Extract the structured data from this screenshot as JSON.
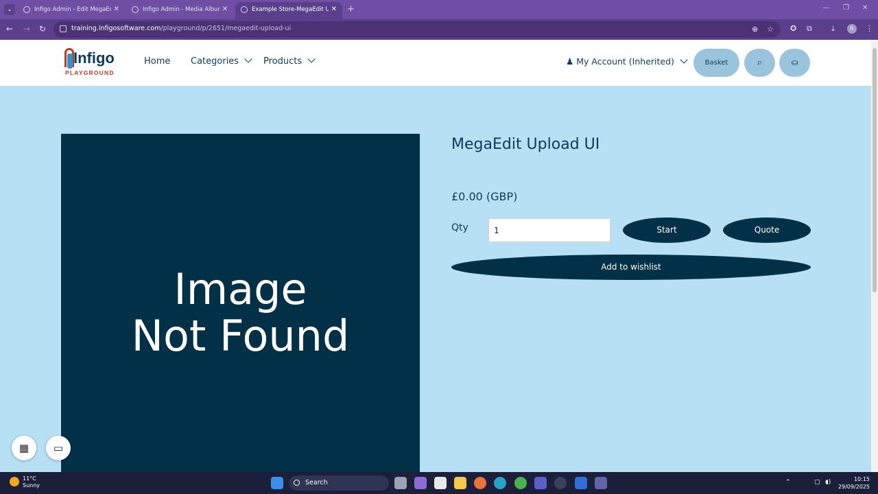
{
  "browser": {
    "tabs": [
      {
        "title": "Infigo Admin - Edit MegaEdit p"
      },
      {
        "title": "Infigo Admin - Media Album Se"
      },
      {
        "title": "Example Store-MegaEdit Uplo"
      }
    ],
    "url_domain": "training.infigosoftware.com",
    "url_path": "/playground/p/2651/megaedit-upload-ui",
    "profile_initial": "h"
  },
  "site": {
    "logo_brand": "Infigo",
    "logo_sub": "PLAYGROUND",
    "nav": [
      {
        "label": "Home"
      },
      {
        "label": "Categories"
      },
      {
        "label": "Products"
      }
    ],
    "account_label": "My Account (Inherited)",
    "basket_label": "Basket"
  },
  "product": {
    "image_placeholder_line1": "Image",
    "image_placeholder_line2": "Not Found",
    "title": "MegaEdit Upload UI",
    "price": "£0.00 (GBP)",
    "qty_label": "Qty",
    "qty_value": "1",
    "start_label": "Start",
    "quote_label": "Quote",
    "wishlist_label": "Add to wishlist"
  },
  "taskbar": {
    "weather_temp": "11°C",
    "weather_desc": "Sunny",
    "search_label": "Search",
    "time": "10:15",
    "date": "29/09/2025"
  },
  "colors": {
    "page_bg": "#b8e0f5",
    "brand_navy": "#023047",
    "header_button": "#9ac4dc",
    "browser_frame": "#6e4fa3"
  }
}
